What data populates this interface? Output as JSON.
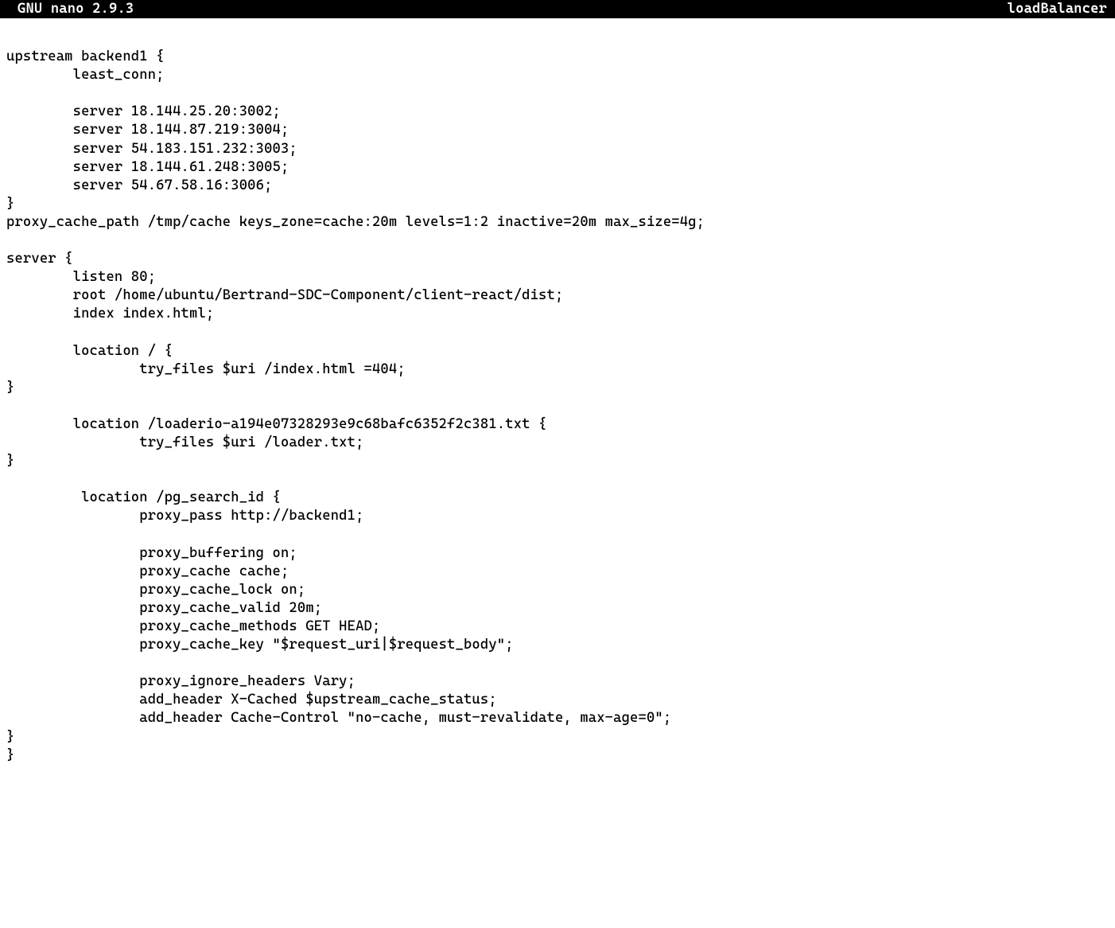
{
  "titlebar": {
    "app_label": "GNU nano 2.9.3",
    "filename": "loadBalancer"
  },
  "editor": {
    "lines": [
      "",
      "upstream backend1 {",
      "        least_conn;",
      "",
      "        server 18.144.25.20:3002;",
      "        server 18.144.87.219:3004;",
      "        server 54.183.151.232:3003;",
      "        server 18.144.61.248:3005;",
      "        server 54.67.58.16:3006;",
      "}",
      "proxy_cache_path /tmp/cache keys_zone=cache:20m levels=1:2 inactive=20m max_size=4g;",
      "",
      "server {",
      "        listen 80;",
      "        root /home/ubuntu/Bertrand-SDC-Component/client-react/dist;",
      "        index index.html;",
      "",
      "        location / {",
      "                try_files $uri /index.html =404;",
      "}",
      "",
      "        location /loaderio-a194e07328293e9c68bafc6352f2c381.txt {",
      "                try_files $uri /loader.txt;",
      "}",
      "",
      "         location /pg_search_id {",
      "                proxy_pass http://backend1;",
      "",
      "                proxy_buffering on;",
      "                proxy_cache cache;",
      "                proxy_cache_lock on;",
      "                proxy_cache_valid 20m;",
      "                proxy_cache_methods GET HEAD;",
      "                proxy_cache_key \"$request_uri|$request_body\";",
      "",
      "                proxy_ignore_headers Vary;",
      "                add_header X-Cached $upstream_cache_status;",
      "                add_header Cache-Control \"no-cache, must-revalidate, max-age=0\";",
      "}",
      "}"
    ]
  }
}
